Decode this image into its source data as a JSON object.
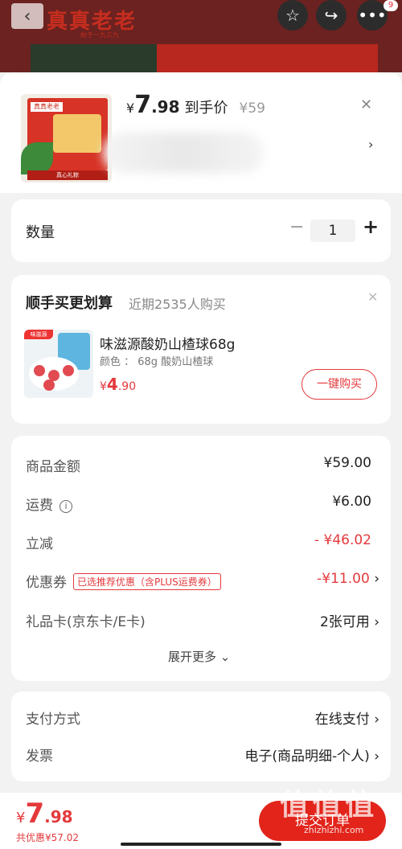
{
  "brand": {
    "logo_text": "真真老老",
    "tagline": "始于一九三九"
  },
  "top_badge": "9",
  "product": {
    "price_symbol": "¥",
    "price_int": "7",
    "price_dec": ".98",
    "price_label": "到手价",
    "original_price": "¥59",
    "thumb_box_text": "真真老老",
    "thumb_ribbon": "真心礼粽"
  },
  "quantity": {
    "label": "数量",
    "minus": "−",
    "value": "1",
    "plus": "+"
  },
  "upsell": {
    "title": "顺手买更划算",
    "subtitle": "近期2535人购买",
    "img_tag": "味滋源",
    "item_name": "味滋源酸奶山楂球68g",
    "item_attr": "颜色 ： 68g  酸奶山楂球",
    "price_symbol": "¥",
    "price_int": "4",
    "price_dec": ".90",
    "buy_button": "一键购买"
  },
  "fees": {
    "goods_label": "商品金额",
    "goods_value": "¥59.00",
    "shipping_label": "运费",
    "shipping_value": "¥6.00",
    "discount_label": "立减",
    "discount_value": "- ¥46.02",
    "coupon_label": "优惠券",
    "coupon_tag": "已选推荐优惠（含PLUS运费券）",
    "coupon_value": "-¥11.00",
    "giftcard_label": "礼品卡(京东卡/E卡)",
    "giftcard_value": "2张可用",
    "expand_more": "展开更多"
  },
  "payment": {
    "method_label": "支付方式",
    "method_value": "在线支付",
    "invoice_label": "发票",
    "invoice_value": "电子(商品明细-个人)"
  },
  "footer": {
    "price_symbol": "¥",
    "price_int": "7",
    "price_dec": ".98",
    "saved": "共优惠¥57.02",
    "submit": "提交订单",
    "watermark": "值 值 值",
    "watermark_url": "zhizhizhi.com"
  },
  "colors": {
    "accent": "#e4393c",
    "submit": "#e2241b"
  }
}
